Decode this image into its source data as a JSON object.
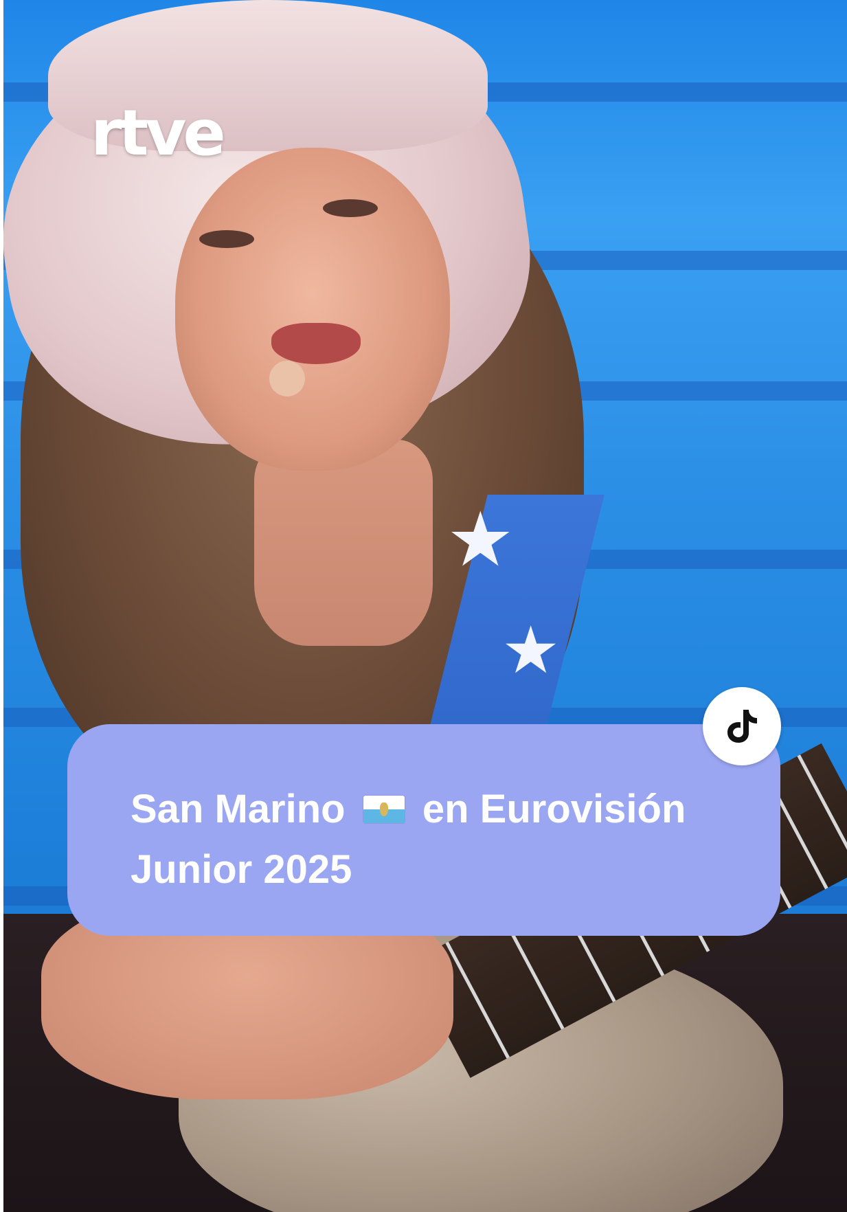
{
  "video": {
    "watermark": "rtve",
    "caption_line1_before_flag": "San Marino",
    "caption_flag_icon": "san-marino-flag-icon",
    "caption_line1_after_flag": "en Eurovisión",
    "caption_line2": "Junior 2025"
  },
  "badge": {
    "icon": "tiktok-logo-icon"
  },
  "colors": {
    "caption_background": "#9ba6f3",
    "caption_text": "#ffffff",
    "stage_blue": "#2f8fe0"
  }
}
